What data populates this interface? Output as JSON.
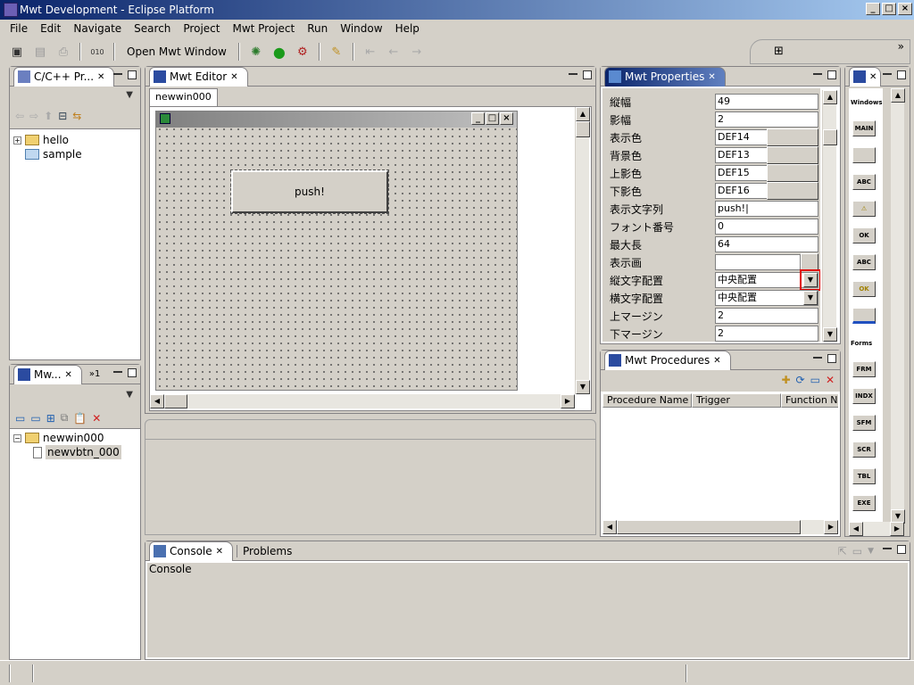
{
  "window": {
    "title": "Mwt Development - Eclipse Platform"
  },
  "menu": [
    "File",
    "Edit",
    "Navigate",
    "Search",
    "Project",
    "Mwt Project",
    "Run",
    "Window",
    "Help"
  ],
  "toolbar": {
    "open_mwt_window": "Open Mwt Window"
  },
  "cpp_projects": {
    "tab": "C/C++ Pr...",
    "items": [
      {
        "label": "hello"
      },
      {
        "label": "sample"
      }
    ]
  },
  "mwt_tree": {
    "tab": "Mw...",
    "overflow": "»1",
    "items": [
      {
        "label": "newwin000"
      },
      {
        "label": "newvbtn_000"
      }
    ]
  },
  "editor": {
    "tab": "Mwt Editor",
    "subtab": "newwin000",
    "button_label": "push!"
  },
  "properties": {
    "tab": "Mwt Properties",
    "rows": [
      {
        "label": "縦幅",
        "value": "49"
      },
      {
        "label": "影幅",
        "value": "2"
      },
      {
        "label": "表示色",
        "value": "DEF14"
      },
      {
        "label": "背景色",
        "value": "DEF13"
      },
      {
        "label": "上影色",
        "value": "DEF15"
      },
      {
        "label": "下影色",
        "value": "DEF16"
      },
      {
        "label": "表示文字列",
        "value": "push!|"
      },
      {
        "label": "フォント番号",
        "value": "0"
      },
      {
        "label": "最大長",
        "value": "64"
      },
      {
        "label": "表示画",
        "value": ""
      },
      {
        "label": "縦文字配置",
        "value": "中央配置"
      },
      {
        "label": "横文字配置",
        "value": "中央配置"
      },
      {
        "label": "上マージン",
        "value": "2"
      },
      {
        "label": "下マージン",
        "value": "2"
      }
    ]
  },
  "procedures": {
    "tab": "Mwt Procedures",
    "columns": [
      "Procedure Name",
      "Trigger",
      "Function Na"
    ]
  },
  "palette": {
    "section1": "Windows",
    "items1": [
      "MAIN",
      "",
      "ABC",
      "⚠",
      "OK",
      "ABC",
      "OK",
      ""
    ],
    "section2": "Forms",
    "items2": [
      "FRM",
      "INDX",
      "SFM",
      "SCR",
      "TBL",
      "EXE"
    ]
  },
  "console": {
    "tab": "Console",
    "tab2": "Problems",
    "header": "Console"
  }
}
